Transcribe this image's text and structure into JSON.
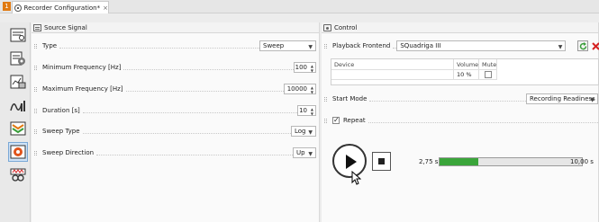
{
  "tab": {
    "number": "1",
    "title": "Recorder Configuration*",
    "close": "×"
  },
  "toolbar": {
    "items": [
      {
        "name": "recorder-tool",
        "selected": false
      },
      {
        "name": "settings-tool",
        "selected": false
      },
      {
        "name": "report-tool",
        "selected": false
      },
      {
        "name": "analysis-tool",
        "selected": false
      },
      {
        "name": "equalizer-tool",
        "selected": false
      },
      {
        "name": "recorder-active-tool",
        "selected": true
      },
      {
        "name": "loop-tool",
        "selected": false
      }
    ]
  },
  "source_signal": {
    "header": "Source Signal",
    "type": {
      "label": "Type",
      "value": "Sweep"
    },
    "min_freq": {
      "label": "Minimum Frequency [Hz]",
      "value": "100"
    },
    "max_freq": {
      "label": "Maximum Frequency [Hz]",
      "value": "10000"
    },
    "duration": {
      "label": "Duration [s]",
      "value": "10"
    },
    "sweep_type": {
      "label": "Sweep Type",
      "value": "Log"
    },
    "sweep_direction": {
      "label": "Sweep Direction",
      "value": "Up"
    }
  },
  "control": {
    "header": "Control",
    "playback_frontend": {
      "label": "Playback Frontend",
      "value": "SQuadriga III"
    },
    "device_table": {
      "columns": [
        "Device",
        "Volume",
        "Mute"
      ],
      "rows": [
        {
          "device": "",
          "volume": "10 %",
          "mute": false
        }
      ]
    },
    "start_mode": {
      "label": "Start Mode",
      "value": "Recording Readiness"
    },
    "repeat": {
      "label": "Repeat",
      "checked": true
    },
    "transport": {
      "elapsed": "2,75 s",
      "total": "10,00 s",
      "progress": 0.275
    }
  },
  "colors": {
    "accent": "#e07a12",
    "progress": "#3aa53a",
    "refresh": "#3a9d3a",
    "close": "#d52222"
  }
}
